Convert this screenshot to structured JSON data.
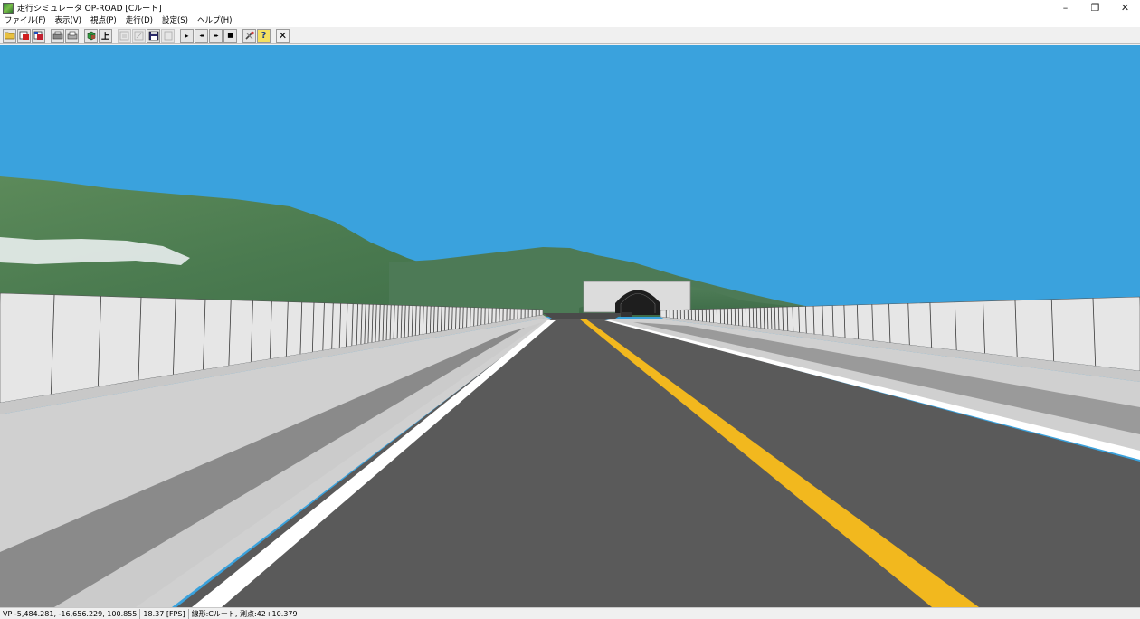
{
  "window": {
    "title": "走行シミュレータ OP-ROAD [Cルート]",
    "controls": {
      "minimize": "–",
      "restore": "❐",
      "close": "✕"
    }
  },
  "menu": [
    {
      "label": "ファイル(F)"
    },
    {
      "label": "表示(V)"
    },
    {
      "label": "視点(P)"
    },
    {
      "label": "走行(D)"
    },
    {
      "label": "設定(S)"
    },
    {
      "label": "ヘルプ(H)"
    }
  ],
  "toolbar": {
    "icons": {
      "open": "folder-open-icon",
      "import_a": "import-red-icon",
      "import_b": "import-blue-icon",
      "print": "printer-icon",
      "print_preview": "print-preview-icon",
      "cube": "cube-3d-icon",
      "ground": "ground-level-icon",
      "export_a": "export-disabled-icon",
      "export_b": "export-disabled-icon-2",
      "save": "floppy-save-icon",
      "export_c": "export-disabled-icon-3",
      "play": "play-icon",
      "rewind": "rewind-icon",
      "fast_forward": "fast-forward-icon",
      "stop": "stop-icon",
      "tools": "tools-icon",
      "help": "help-icon",
      "close": "close-icon"
    },
    "glyphs": {
      "play": "▸",
      "rewind": "◂◂",
      "fast_forward": "▸▸",
      "stop": "■",
      "help": "?",
      "close": "✕",
      "ground": "上"
    }
  },
  "colors": {
    "sky": "#3aa2dd",
    "asphalt": "#5a5a5a",
    "center_line": "#f2b81e",
    "edge_line": "#ffffff",
    "barrier": "#e6e6e6",
    "shoulder": "#d2d2d2",
    "mountain": "#4a7a4f"
  },
  "status": {
    "viewpoint": "VP -5,484.281, -16,656.229, 100.855",
    "fps": "18.37 [FPS]",
    "route": "線形:Cルート, 測点:42+10.379"
  }
}
